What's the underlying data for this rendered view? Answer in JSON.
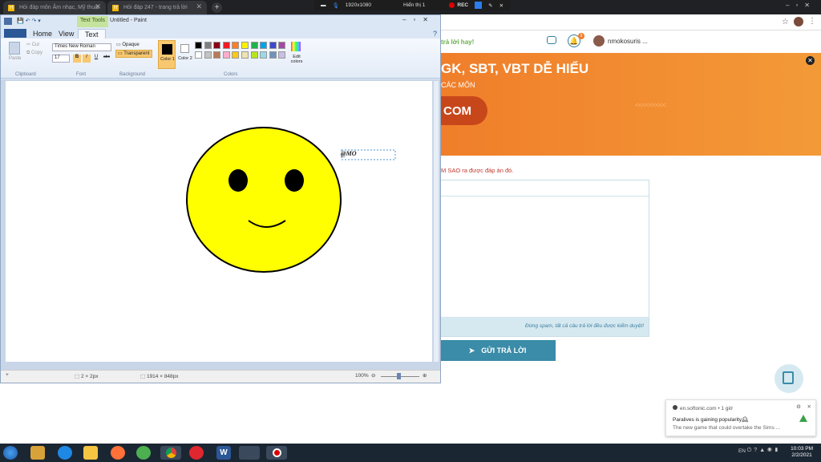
{
  "browser": {
    "tabs": [
      {
        "label": "Hỏi đáp môn Âm nhạc, Mỹ thuật"
      },
      {
        "label": "Hỏi đáp 247 - trang trả lời"
      }
    ],
    "new_tab": "+"
  },
  "recorder": {
    "resolution": "1920x1080",
    "display": "Hiển thị 1",
    "rec": "REC"
  },
  "site": {
    "tagline": "trả lời hay!",
    "username": "nmokosuris ...",
    "bell_count": "9",
    "banner_line1": "GK, SBT, VBT DỄ HIỂU",
    "banner_line2": "CÁC MÔN",
    "banner_btn": "COM",
    "banner_arrows": "<<<<<<<<<",
    "banner_close": "✕",
    "question_hint": "M SAO ra được đáp án đó.",
    "spam_note": "Đừng spam, tất cả câu trả lời đều được kiểm duyệt!",
    "submit": "GỬI TRẢ LỜI",
    "notification": {
      "source": "en.softonic.com • 1 giờ",
      "title": "Paralives is gaining popularity🕰",
      "body": "The new game that could overtake the Sims ..."
    }
  },
  "paint": {
    "title": "Untitled - Paint",
    "text_tools": "Text Tools",
    "tabs": [
      "Home",
      "View",
      "Text"
    ],
    "clipboard": {
      "paste": "Paste",
      "cut": "Cut",
      "copy": "Copy",
      "label": "Clipboard"
    },
    "font": {
      "family": "Times New Roman",
      "size": "17",
      "label": "Font",
      "bold": "B",
      "italic": "I",
      "underline": "U",
      "strike": "abc"
    },
    "background": {
      "opaque": "Opaque",
      "transparent": "Transparent",
      "label": "Background"
    },
    "colors": {
      "color1": "Color 1",
      "color2": "Color 2",
      "edit": "Edit colors",
      "label": "Colors"
    },
    "canvas_text": "@MO",
    "status": {
      "cursor": "2 × 2px",
      "size": "1914 × 848px",
      "zoom": "100%"
    }
  },
  "palette": [
    "#000000",
    "#7f7f7f",
    "#880015",
    "#ed1c24",
    "#ff7f27",
    "#fff200",
    "#22b14c",
    "#00a2e8",
    "#3f48cc",
    "#a349a4",
    "#ffffff",
    "#c3c3c3",
    "#b97a57",
    "#ffaec9",
    "#ffc90e",
    "#efe4b0",
    "#b5e61d",
    "#99d9ea",
    "#7092be",
    "#c8bfe7"
  ],
  "taskbar": {
    "time": "10:03 PM",
    "date": "2/2/2021",
    "lang": "EN"
  }
}
